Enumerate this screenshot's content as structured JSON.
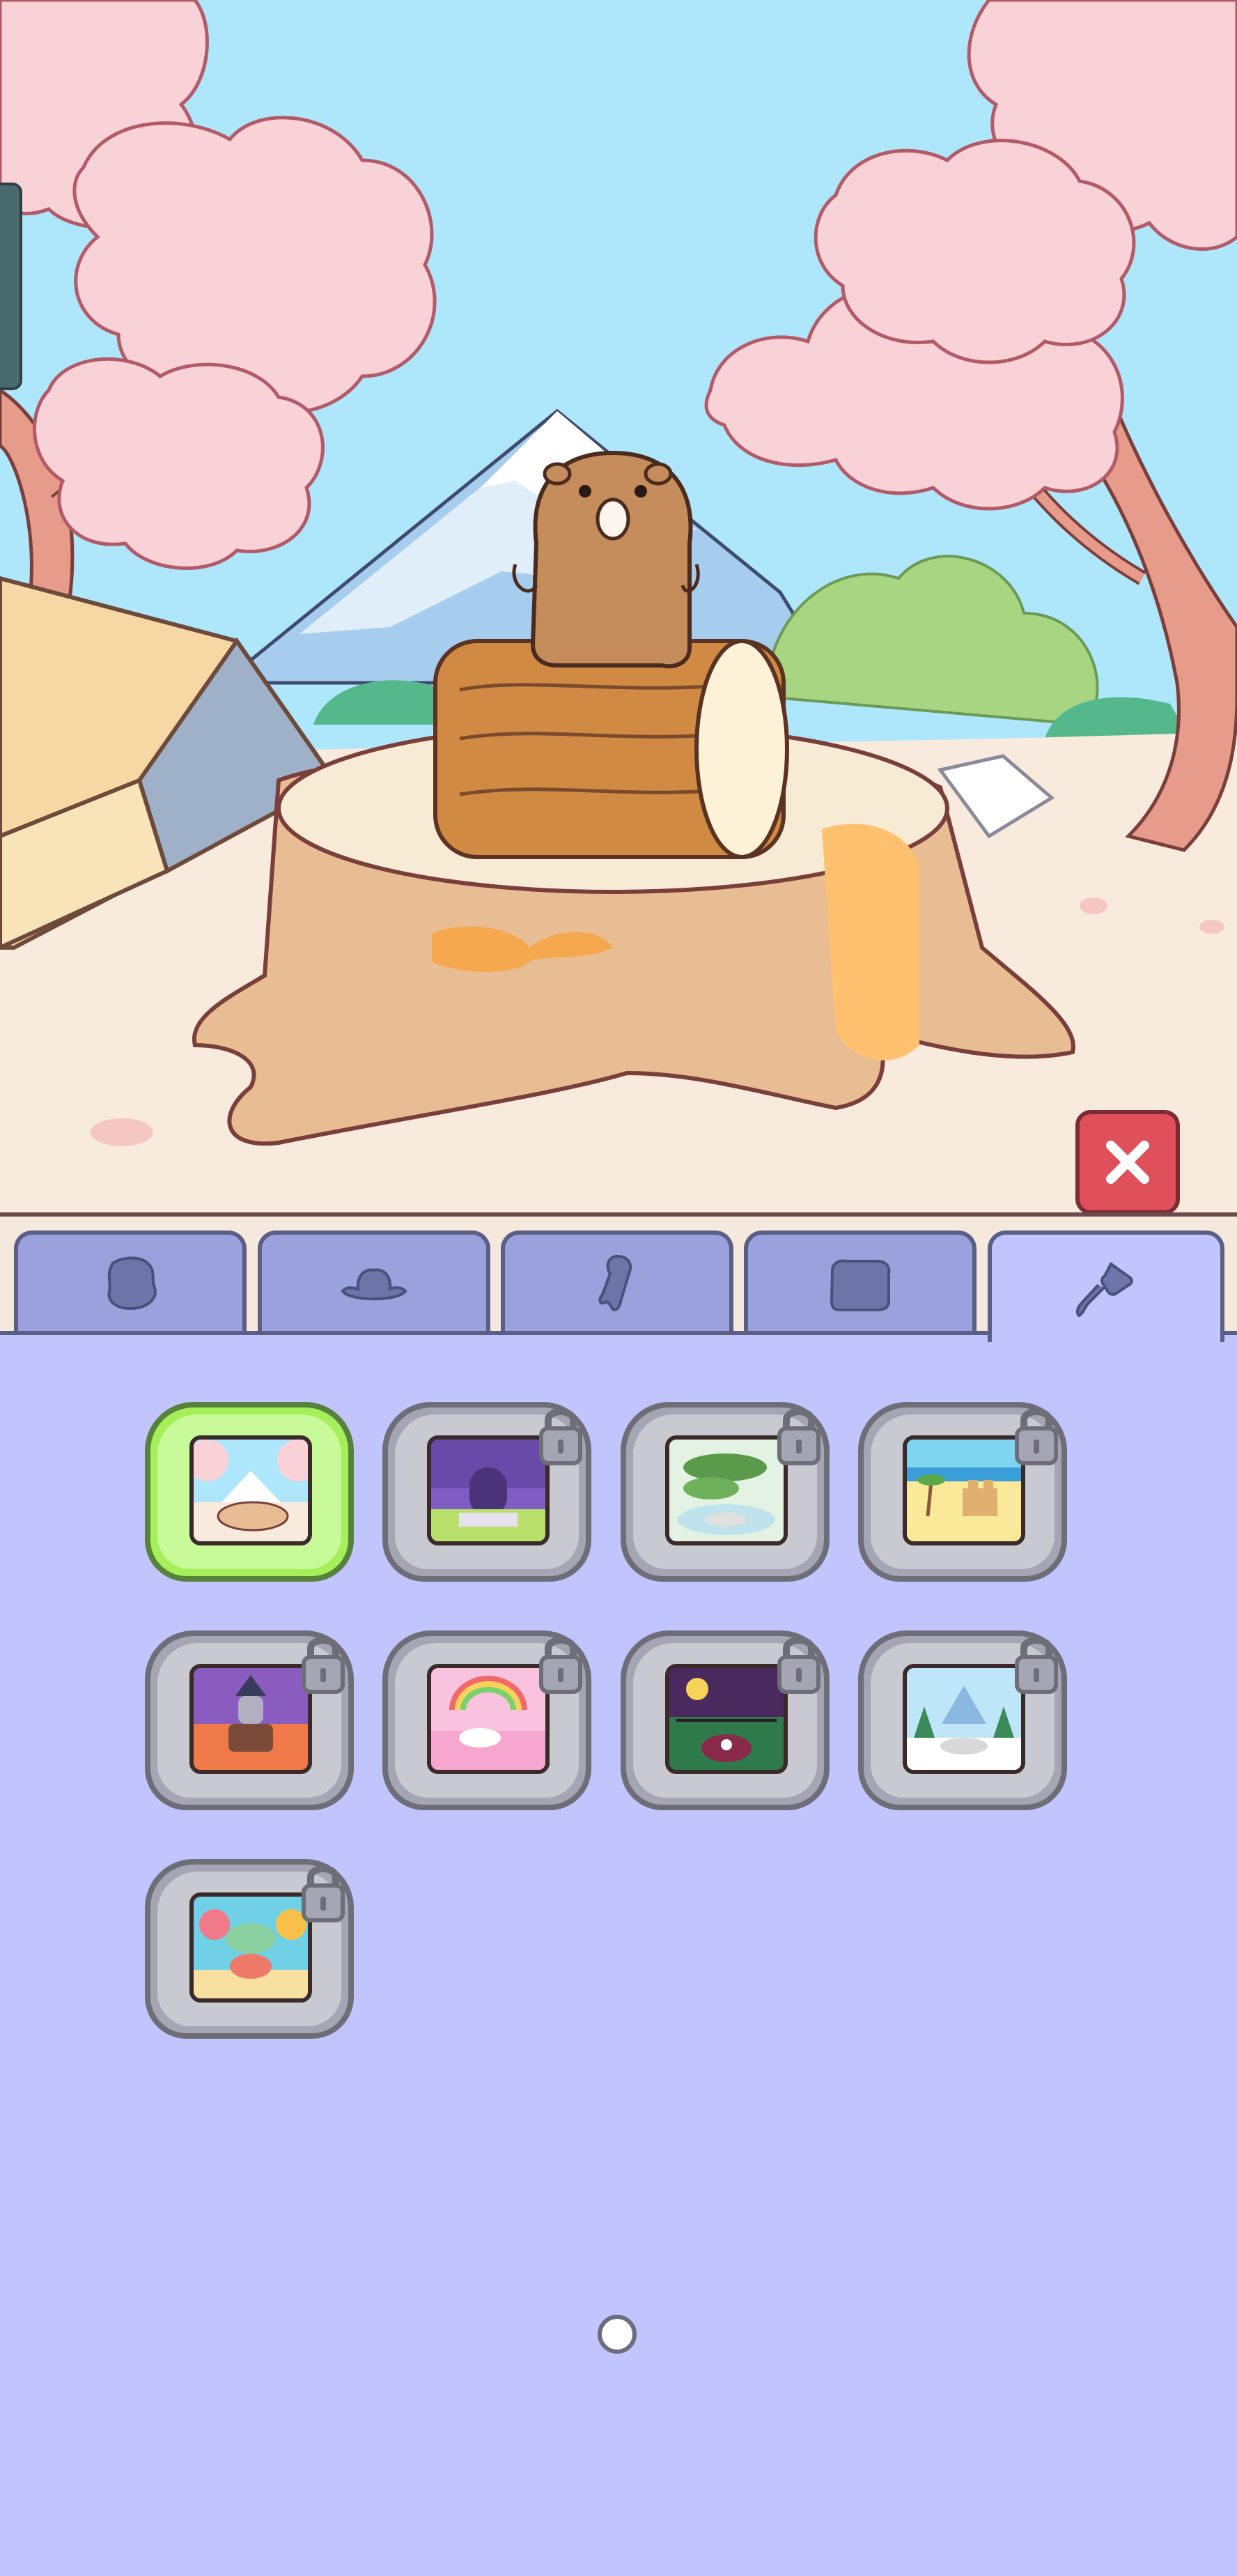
{
  "screen": "background-selector",
  "colors": {
    "sky": "#aee6fb",
    "panel": "#c1c4fd",
    "tab": "#9aa1dd",
    "tab_border": "#5b5e85",
    "close_button": "#e0505a",
    "selected_frame": "#a4ef5a",
    "locked_frame": "#a5a6b3"
  },
  "scene": {
    "description_icons": [
      "capybara",
      "log",
      "tree-stump",
      "tent",
      "cherry-blossom-tree",
      "mountain",
      "open-book"
    ]
  },
  "close_button": {
    "icon": "close-icon"
  },
  "tabs": [
    {
      "icon": "body-icon",
      "active": false
    },
    {
      "icon": "hat-icon",
      "active": false
    },
    {
      "icon": "accessory-icon",
      "active": false
    },
    {
      "icon": "item-icon",
      "active": false
    },
    {
      "icon": "paintbrush-icon",
      "active": true
    }
  ],
  "backgrounds": [
    {
      "theme": "cherry-blossom-stump",
      "locked": false,
      "selected": true
    },
    {
      "theme": "purple-graveyard",
      "locked": true,
      "selected": false
    },
    {
      "theme": "bonsai-hot-spring",
      "locked": true,
      "selected": false
    },
    {
      "theme": "sandcastle-beach",
      "locked": true,
      "selected": false
    },
    {
      "theme": "wizard-lava",
      "locked": true,
      "selected": false
    },
    {
      "theme": "rainbow-candy",
      "locked": true,
      "selected": false
    },
    {
      "theme": "haunted-night",
      "locked": true,
      "selected": false
    },
    {
      "theme": "snowy-mountains",
      "locked": true,
      "selected": false
    },
    {
      "theme": "coral-reef",
      "locked": true,
      "selected": false
    }
  ],
  "pagination": {
    "current": 1,
    "total": 1
  }
}
